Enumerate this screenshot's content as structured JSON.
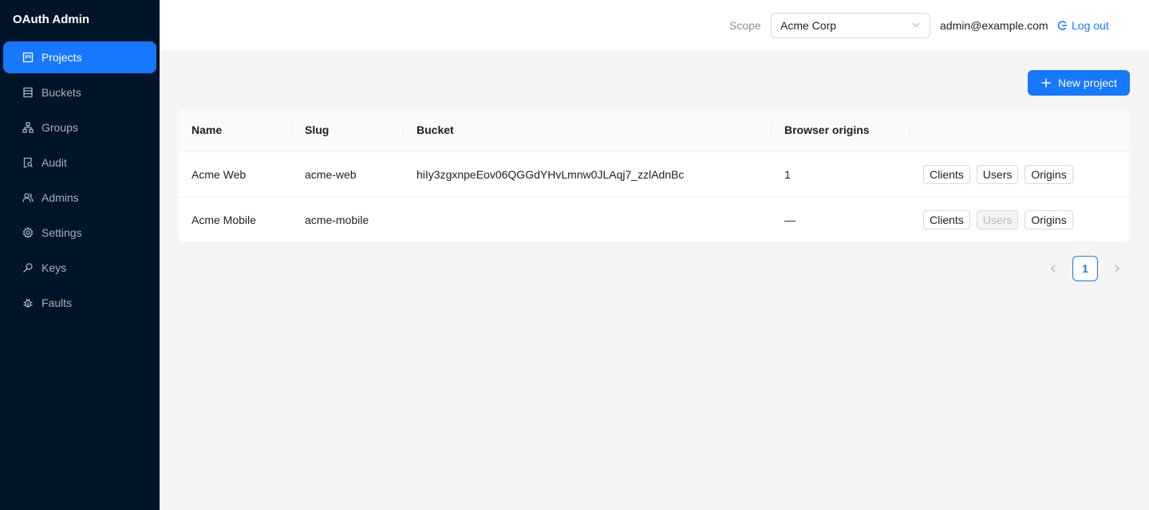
{
  "app": {
    "title": "OAuth Admin"
  },
  "sidebar": {
    "items": [
      {
        "label": "Projects",
        "icon": "project-icon",
        "active": true
      },
      {
        "label": "Buckets",
        "icon": "database-icon"
      },
      {
        "label": "Groups",
        "icon": "cluster-icon"
      },
      {
        "label": "Audit",
        "icon": "file-search-icon"
      },
      {
        "label": "Admins",
        "icon": "team-icon"
      },
      {
        "label": "Settings",
        "icon": "gear-icon"
      },
      {
        "label": "Keys",
        "icon": "key-icon"
      },
      {
        "label": "Faults",
        "icon": "bug-icon"
      }
    ]
  },
  "header": {
    "scope_label": "Scope",
    "scope_value": "Acme Corp",
    "user_email": "admin@example.com",
    "logout_label": "Log out"
  },
  "toolbar": {
    "new_project_label": "New project"
  },
  "table": {
    "columns": [
      "Name",
      "Slug",
      "Bucket",
      "Browser origins",
      ""
    ],
    "rows": [
      {
        "name": "Acme Web",
        "slug": "acme-web",
        "bucket": "hiIy3zgxnpeEov06QGGdYHvLmnw0JLAqj7_zzlAdnBc",
        "origins": "1",
        "actions": {
          "clients": "Clients",
          "users": "Users",
          "origins": "Origins",
          "users_disabled": false
        }
      },
      {
        "name": "Acme Mobile",
        "slug": "acme-mobile",
        "bucket": "",
        "origins": "—",
        "actions": {
          "clients": "Clients",
          "users": "Users",
          "origins": "Origins",
          "users_disabled": true
        }
      }
    ]
  },
  "pagination": {
    "current_page": "1"
  },
  "colors": {
    "primary": "#1677ff",
    "sidebar_bg": "#001529",
    "content_bg": "#f5f5f5"
  }
}
